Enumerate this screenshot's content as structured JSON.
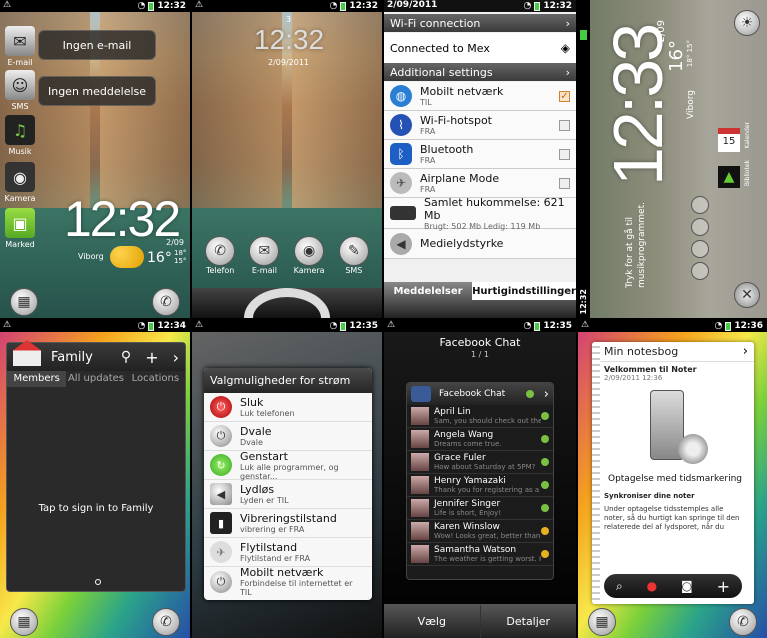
{
  "status_bars": {
    "p1_time": "12:32",
    "p2_time": "12:32",
    "p3_time": "12:32",
    "p3_date": "2/09/2011",
    "p5_time": "12:34",
    "p6_time": "12:35",
    "p7_time": "12:35",
    "p8_time": "12:36"
  },
  "p1": {
    "shortcuts": [
      {
        "label": "E-mail",
        "pill": "Ingen e-mail"
      },
      {
        "label": "SMS",
        "pill": "Ingen meddelelse"
      },
      {
        "label": "Musik"
      },
      {
        "label": "Kamera"
      },
      {
        "label": "Marked"
      }
    ],
    "clock": "12:32",
    "city": "Viborg",
    "date": "2/09",
    "temp": "16°",
    "hi": "18°",
    "lo": "15°"
  },
  "p2": {
    "clock": "12:32",
    "date": "2/09/2011",
    "notif_count": "3",
    "dock": [
      "Telefon",
      "E-mail",
      "Kamera",
      "SMS"
    ]
  },
  "p3": {
    "wifi_header": "Wi-Fi connection",
    "wifi_status": "Connected to Mex",
    "additional_header": "Additional settings",
    "items": [
      {
        "title": "Mobilt netværk",
        "sub": "TIL",
        "checked": true
      },
      {
        "title": "Wi-Fi-hotspot",
        "sub": "FRA",
        "checked": false
      },
      {
        "title": "Bluetooth",
        "sub": "FRA",
        "checked": false
      },
      {
        "title": "Airplane Mode",
        "sub": "FRA",
        "checked": false
      }
    ],
    "memory_title": "Samlet hukommelse: 621 Mb",
    "memory_sub": "Brugt: 502 Mb   Ledig: 119 Mb",
    "volume": "Medielydstyrke",
    "tabs": [
      "Meddelelser",
      "Hurtigindstillinger"
    ]
  },
  "p4": {
    "clock": "12:33",
    "date": "2/09",
    "temp": "16°",
    "hi": "18°",
    "lo": "15°",
    "city": "Viborg",
    "hint": "Tryk for at gå til musikprogrammet.",
    "calendar_day": "15",
    "calendar_label": "Kalender",
    "music_label": "Bibliotek"
  },
  "p5": {
    "title": "Family",
    "tabs": [
      "Members",
      "All updates",
      "Locations"
    ],
    "message": "Tap to sign in to Family"
  },
  "p6": {
    "title": "Valgmuligheder for strøm",
    "items": [
      {
        "title": "Sluk",
        "sub": "Luk telefonen"
      },
      {
        "title": "Dvale",
        "sub": "Dvale"
      },
      {
        "title": "Genstart",
        "sub": "Luk alle programmer, og genstar..."
      },
      {
        "title": "Lydløs",
        "sub": "Lyden er TIL"
      },
      {
        "title": "Vibreringstilstand",
        "sub": "vibrering er FRA"
      },
      {
        "title": "Flytilstand",
        "sub": "Flytilstand er FRA"
      },
      {
        "title": "Mobilt netværk",
        "sub": "Forbindelse til internettet er TIL"
      }
    ]
  },
  "p7": {
    "title": "Facebook Chat",
    "page": "1 / 1",
    "widget_title": "Facebook Chat",
    "contacts": [
      {
        "name": "April Lin",
        "status": "Sam, you should check out the n"
      },
      {
        "name": "Angela Wang",
        "status": "Dreams come true."
      },
      {
        "name": "Grace Fuler",
        "status": "How about Saturday at 5PM?"
      },
      {
        "name": "Henry Yamazaki",
        "status": "Thank you for registering as a m"
      },
      {
        "name": "Jennifer Singer",
        "status": "Life is short, Enjoy!"
      },
      {
        "name": "Karen Winslow",
        "status": "Wow! Looks great, better than I"
      },
      {
        "name": "Samantha Watson",
        "status": "The weather is getting worst. Ha"
      }
    ],
    "buttons": [
      "Vælg",
      "Detaljer"
    ],
    "colors": {
      "online": "#7ac043",
      "away": "#e8b020"
    }
  },
  "p8": {
    "title": "Min notesbog",
    "note_title": "Velkommen til Noter",
    "note_date": "2/09/2011 12:36",
    "caption": "Optagelse med tidsmarkering",
    "sub_heading": "Synkroniser dine noter",
    "body": "Under optagelse tidsstemples alle noter, så du hurtigt kan springe til den relaterede del af lydsporet, når du"
  }
}
